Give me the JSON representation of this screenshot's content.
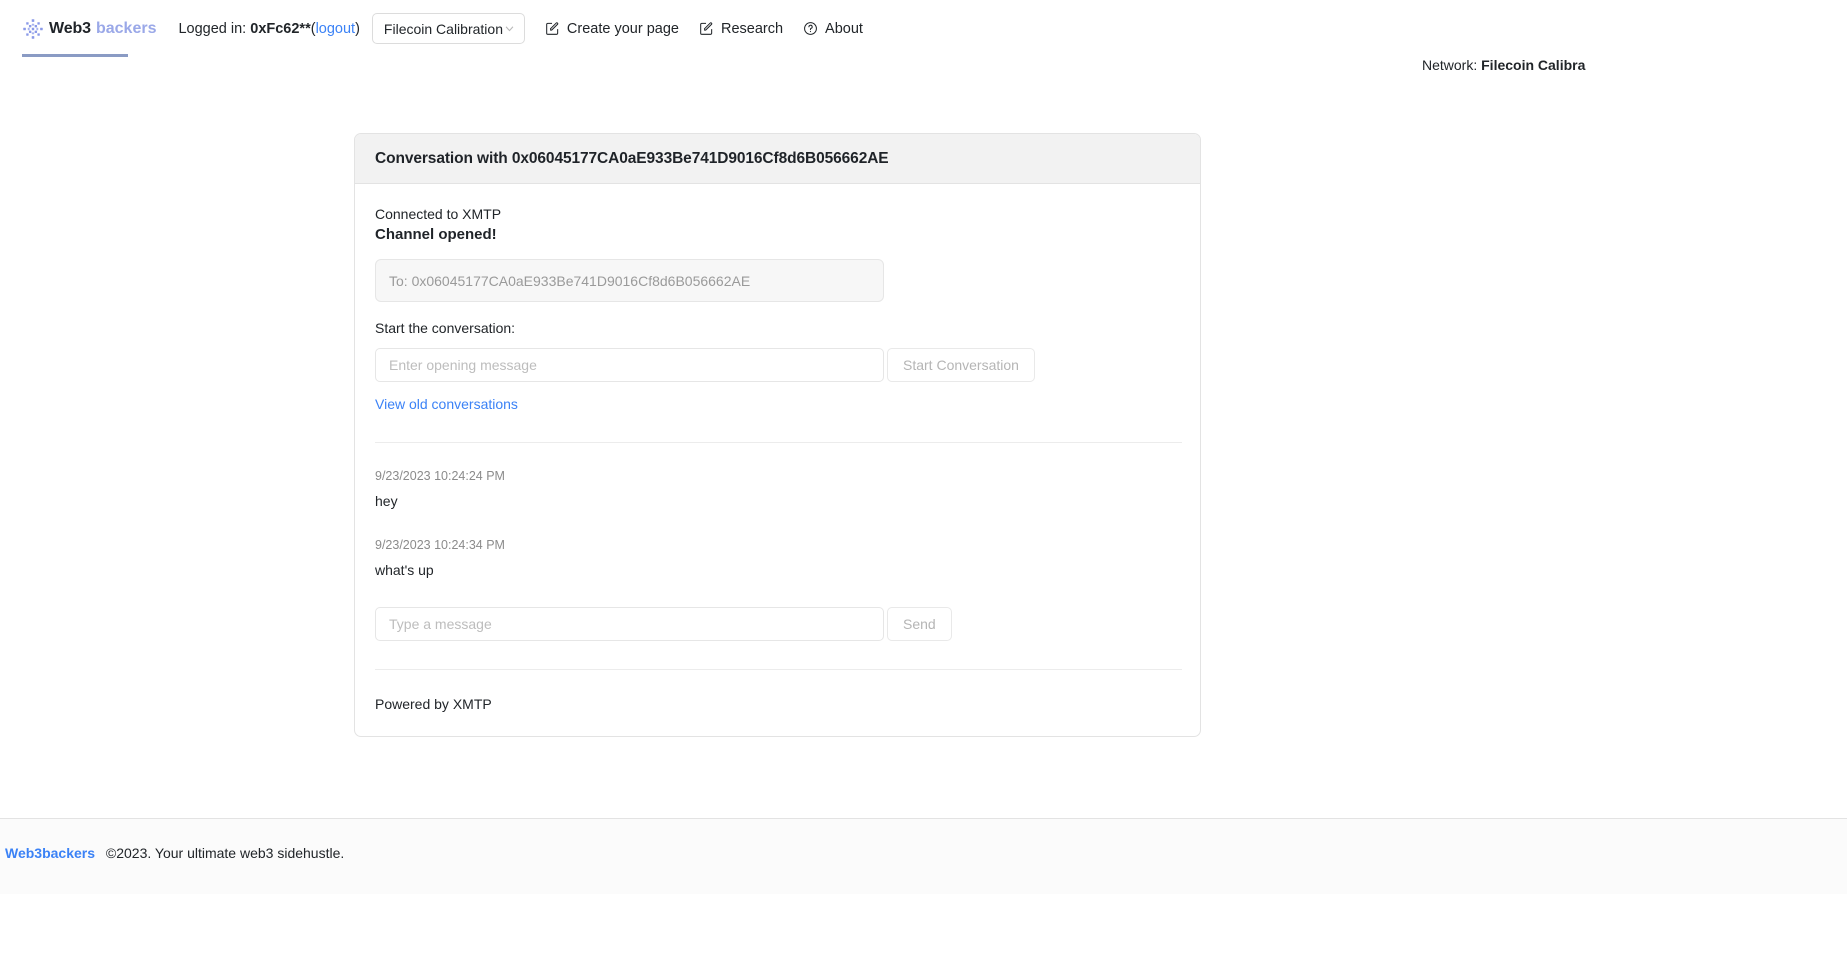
{
  "navbar": {
    "brand": {
      "part1": "Web3",
      "part2": "backers",
      "icon": "snowflake-logo-icon"
    },
    "logged_in_prefix": "Logged in:",
    "logged_in_address": "0xFc62**",
    "logout_open_paren": "(",
    "logout_label": "logout",
    "logout_close_paren": ")",
    "network_select": {
      "value": "Filecoin Calibration",
      "chevron_icon": "chevron-down-icon"
    },
    "links": [
      {
        "label": "Create your page",
        "icon": "pencil-square-icon"
      },
      {
        "label": "Research",
        "icon": "pencil-square-icon"
      },
      {
        "label": "About",
        "icon": "question-circle-icon"
      }
    ]
  },
  "network_banner": {
    "prefix": "Network:",
    "value": "Filecoin Calibra"
  },
  "card": {
    "title": "Conversation with 0x06045177CA0aE933Be741D9016Cf8d6B056662AE",
    "status_connected": "Connected to XMTP",
    "status_channel": "Channel opened!",
    "to_field": {
      "value": "To: 0x06045177CA0aE933Be741D9016Cf8d6B056662AE"
    },
    "start_label": "Start the conversation:",
    "opening_message_input": {
      "value": "",
      "placeholder": "Enter opening message"
    },
    "start_button_label": "Start Conversation",
    "view_old_link": "View old conversations",
    "messages": [
      {
        "timestamp": "9/23/2023 10:24:24 PM",
        "text": "hey"
      },
      {
        "timestamp": "9/23/2023 10:24:34 PM",
        "text": "what's up"
      }
    ],
    "message_input": {
      "value": "",
      "placeholder": "Type a message"
    },
    "send_button_label": "Send",
    "powered_by": "Powered by XMTP"
  },
  "footer": {
    "brand": "Web3backers",
    "text": "©2023. Your ultimate web3 sidehustle."
  },
  "colors": {
    "accent_blue": "#3b82f6",
    "brand_light": "#9aa8e8",
    "card_header_bg": "#f2f2f2",
    "muted_text": "#8b8b8b"
  }
}
